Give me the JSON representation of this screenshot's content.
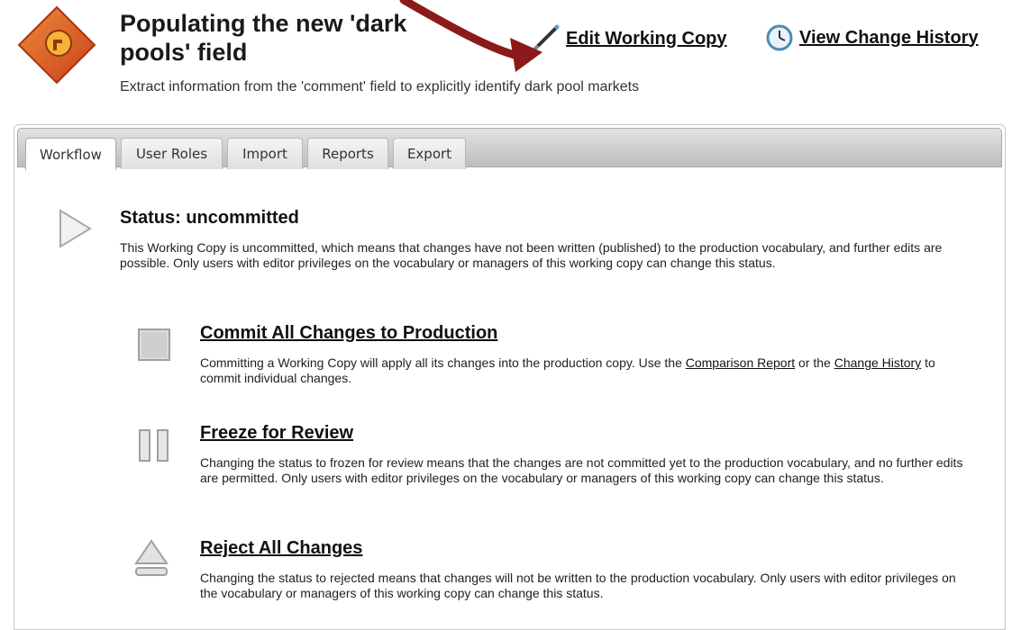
{
  "header": {
    "title": "Populating the new 'dark pools' field",
    "subtitle": "Extract information from the 'comment' field to explicitly identify dark pool markets",
    "edit_link": "Edit Working Copy",
    "history_link": "View Change History",
    "logo_icon": "wrench-diamond-icon",
    "edit_icon": "pencil-icon",
    "history_icon": "clock-icon"
  },
  "tabs": [
    {
      "label": "Workflow",
      "active": true
    },
    {
      "label": "User Roles",
      "active": false
    },
    {
      "label": "Import",
      "active": false
    },
    {
      "label": "Reports",
      "active": false
    },
    {
      "label": "Export",
      "active": false
    }
  ],
  "status": {
    "title": "Status: uncommitted",
    "description": "This Working Copy is uncommitted, which means that changes have not been written (published) to the production vocabulary, and further edits are possible. Only users with editor privileges on the vocabulary or managers of this working copy can change this status."
  },
  "actions": [
    {
      "title": "Commit All Changes to Production",
      "icon": "stop-icon",
      "desc_before": "Committing a Working Copy will apply all its changes into the production copy. Use the ",
      "link1": "Comparison Report",
      "desc_middle": " or the ",
      "link2": "Change History",
      "desc_after": " to commit individual changes."
    },
    {
      "title": "Freeze for Review",
      "icon": "pause-icon",
      "description": "Changing the status to frozen for review means that the changes are not committed yet to the production vocabulary, and no further edits are permitted. Only users with editor privileges on the vocabulary or managers of this working copy can change this status."
    },
    {
      "title": "Reject All Changes",
      "icon": "eject-icon",
      "description": "Changing the status to rejected means that changes will not be written to the production vocabulary. Only users with editor privileges on the vocabulary or managers of this working copy can change this status."
    }
  ],
  "colors": {
    "arrow": "#8b1a1a",
    "logo_orange": "#e2571e",
    "tab_bar": "#c9c9c9"
  }
}
